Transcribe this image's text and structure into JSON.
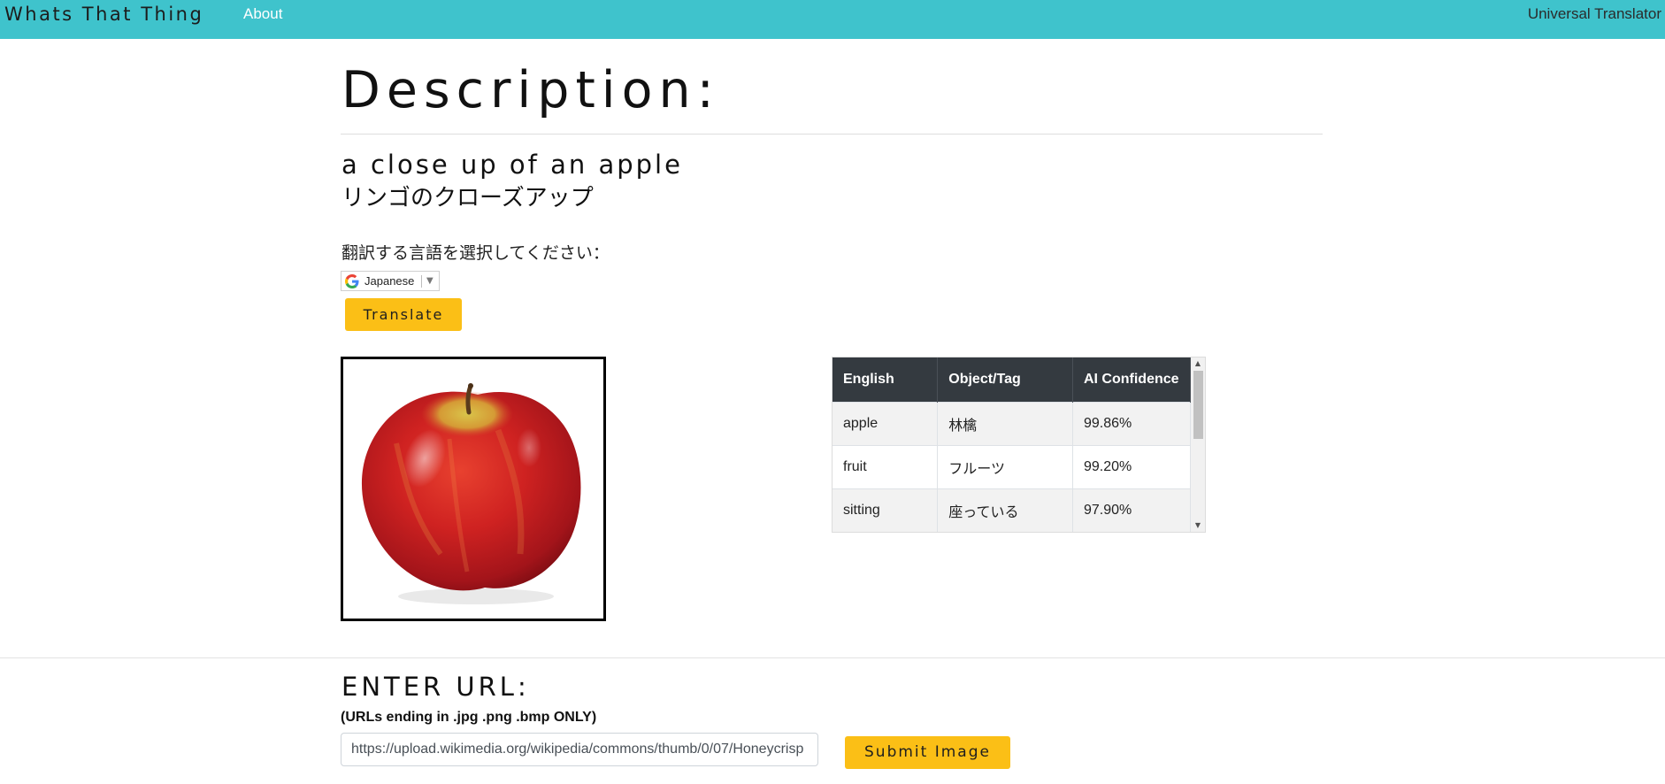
{
  "navbar": {
    "brand": "Whats That Thing",
    "about": "About",
    "right_link": "Universal Translator",
    "background_color": "#3fc3cc"
  },
  "description": {
    "heading": "Description:",
    "caption_english": "a close up of an apple",
    "caption_translated": "リンゴのクローズアップ"
  },
  "translate": {
    "select_label": "翻訳する言語を選択してください：",
    "selected_language": "Japanese",
    "provider_icon": "google-g-icon",
    "dropdown_icon": "chevron-down-icon",
    "button_label": "Translate",
    "button_color": "#fbbf16"
  },
  "image": {
    "subject_icon": "red-apple-photo"
  },
  "tags_table": {
    "headers": [
      "English",
      "Object/Tag",
      "AI Confidence"
    ],
    "rows": [
      {
        "english": "apple",
        "tag": "林檎",
        "confidence": "99.86%"
      },
      {
        "english": "fruit",
        "tag": "フルーツ",
        "confidence": "99.20%"
      },
      {
        "english": "sitting",
        "tag": "座っている",
        "confidence": "97.90%"
      }
    ],
    "header_color": "#343a40"
  },
  "url_section": {
    "title": "ENTER URL:",
    "note": "(URLs ending in .jpg .png .bmp ONLY)",
    "input_value": "https://upload.wikimedia.org/wikipedia/commons/thumb/0/07/Honeycrisp",
    "submit_label": "Submit Image"
  }
}
